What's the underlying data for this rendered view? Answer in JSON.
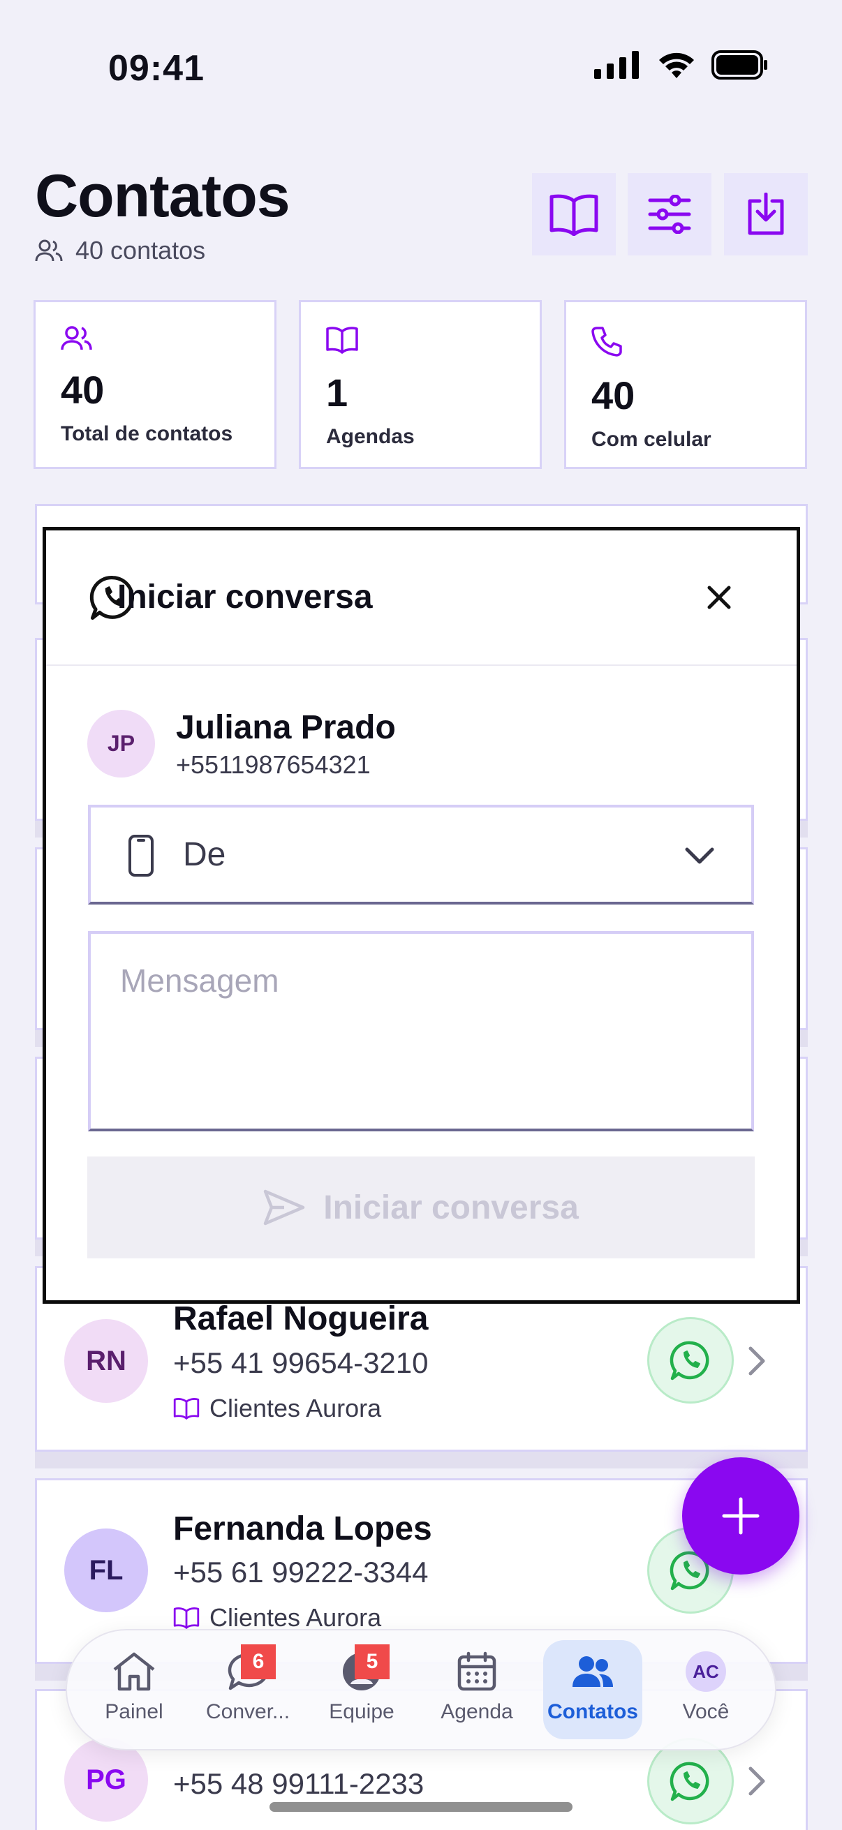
{
  "status_bar": {
    "time": "09:41"
  },
  "header": {
    "title": "Contatos",
    "count_label": "40 contatos",
    "buttons": [
      "book-icon",
      "sliders-icon",
      "download-icon"
    ]
  },
  "stats": [
    {
      "icon": "users-icon",
      "value": "40",
      "label": "Total de contatos"
    },
    {
      "icon": "book-icon",
      "value": "1",
      "label": "Agendas"
    },
    {
      "icon": "phone-icon",
      "value": "40",
      "label": "Com celular"
    }
  ],
  "contacts": [
    {
      "initials": "RN",
      "name": "Rafael Nogueira",
      "phone": "+55 41 99654-3210",
      "agenda": "Clientes Aurora"
    },
    {
      "initials": "FL",
      "name": "Fernanda Lopes",
      "phone": "+55 61 99222-3344",
      "agenda": "Clientes Aurora"
    },
    {
      "initials": "PG",
      "name": "",
      "phone": "+55 48 99111-2233",
      "agenda": ""
    }
  ],
  "modal": {
    "title": "Iniciar conversa",
    "contact_initials": "JP",
    "contact_name": "Juliana Prado",
    "contact_phone": "+5511987654321",
    "from_label": "De",
    "message_placeholder": "Mensagem",
    "submit_label": "Iniciar conversa"
  },
  "tabs": [
    {
      "label": "Painel",
      "icon": "home-icon",
      "badge": ""
    },
    {
      "label": "Conver...",
      "icon": "chat-icon",
      "badge": "6"
    },
    {
      "label": "Equipe",
      "icon": "team-icon",
      "badge": "5"
    },
    {
      "label": "Agenda",
      "icon": "calendar-icon",
      "badge": ""
    },
    {
      "label": "Contatos",
      "icon": "contacts-icon",
      "badge": "",
      "active": true
    },
    {
      "label": "Você",
      "icon": "avatar",
      "badge": "",
      "initials": "AC"
    }
  ],
  "colors": {
    "accent": "#8a08f0",
    "active_tab": "#1d5ed8",
    "whatsapp": "#22b04b",
    "badge": "#f04a4a"
  }
}
